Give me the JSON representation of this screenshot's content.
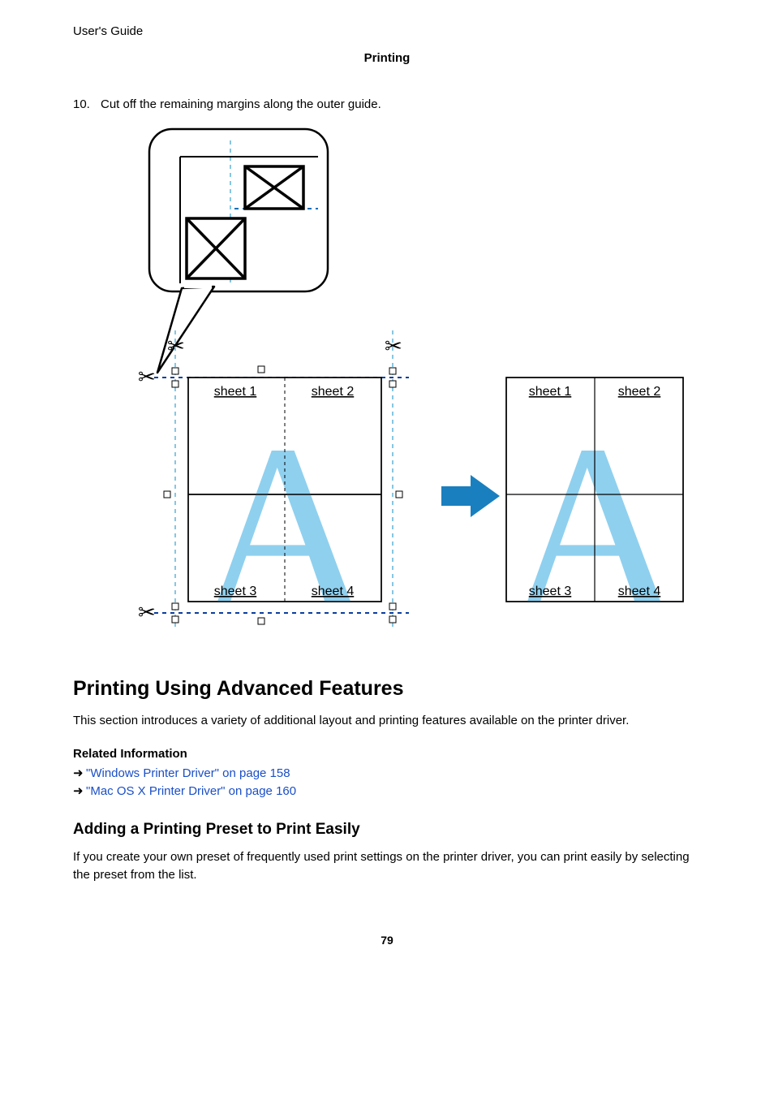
{
  "header": {
    "guide": "User's Guide",
    "section": "Printing"
  },
  "step": {
    "number": "10.",
    "text": "Cut off the remaining margins along the outer guide."
  },
  "figure": {
    "sheet1": "sheet 1",
    "sheet2": "sheet 2",
    "sheet3": "sheet 3",
    "sheet4": "sheet 4",
    "sheet1b": "sheet 1",
    "sheet2b": "sheet 2",
    "sheet3b": "sheet 3",
    "sheet4b": "sheet 4"
  },
  "h2": "Printing Using Advanced Features",
  "intro": "This section introduces a variety of additional layout and printing features available on the printer driver.",
  "related": {
    "heading": "Related Information",
    "links": [
      "\"Windows Printer Driver\" on page 158",
      "\"Mac OS X Printer Driver\" on page 160"
    ]
  },
  "h3": "Adding a Printing Preset to Print Easily",
  "h3body": "If you create your own preset of frequently used print settings on the printer driver, you can print easily by selecting the preset from the list.",
  "pagenum": "79"
}
